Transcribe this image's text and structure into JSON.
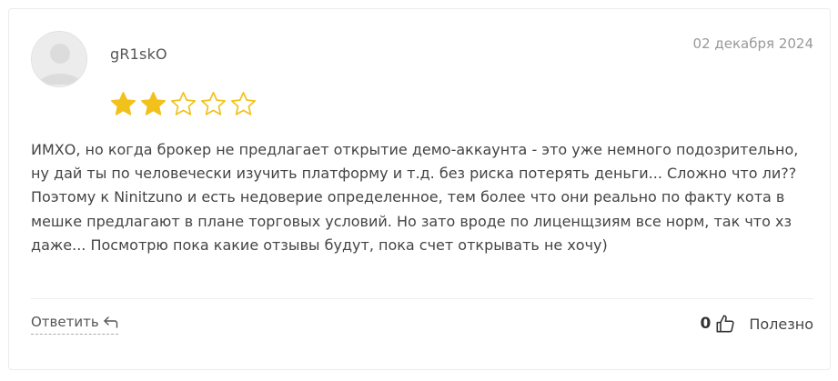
{
  "review": {
    "author": "gR1skO",
    "date": "02 декабря 2024",
    "rating": 2,
    "max_rating": 5,
    "text": "ИМХО, но когда брокер не предлагает открытие демо-аккаунта - это уже немного подозрительно, ну дай ты по человечески изучить платформу и т.д. без риска потерять деньги... Сложно что ли?? Поэтому к Ninitzuno и есть недоверие определенное, тем более что они реально по факту кота в мешке предлагают в плане торговых условий. Но зато вроде по лиценщзиям все норм, так что хз даже... Посмотрю пока какие отзывы будут, пока счет открывать не хочу)"
  },
  "actions": {
    "reply_label": "Ответить",
    "helpful_count": "0",
    "helpful_label": "Полезно"
  },
  "icons": {
    "avatar": "user-avatar-placeholder",
    "star_filled": "star-filled-icon",
    "star_empty": "star-outline-icon",
    "reply": "reply-arrow-icon",
    "thumb": "thumbs-up-icon"
  },
  "colors": {
    "star": "#f2c11b",
    "text": "#444444",
    "muted": "#999999"
  }
}
